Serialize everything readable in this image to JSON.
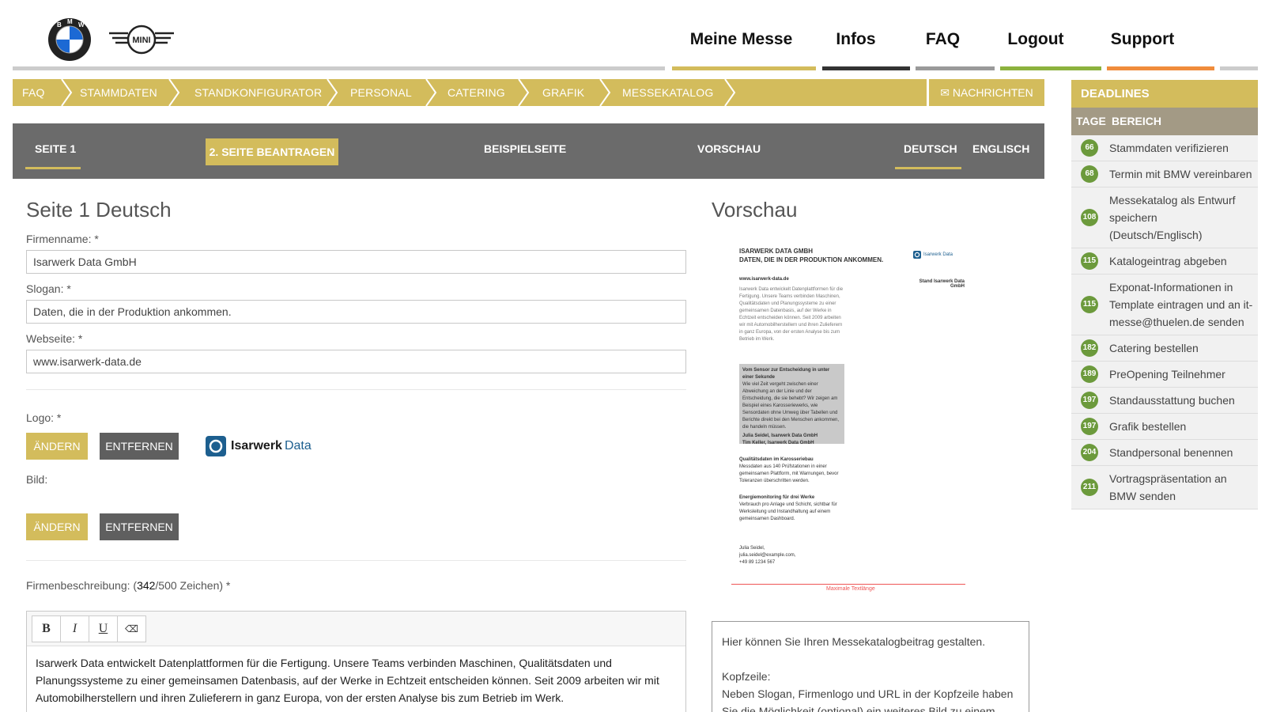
{
  "header": {
    "logos": [
      "bmw-logo",
      "mini-logo"
    ],
    "mini_logo_text": "MINI",
    "nav": [
      {
        "label": "Meine Messe",
        "color": "#d3bc5c"
      },
      {
        "label": "Infos",
        "color": "#333333"
      },
      {
        "label": "FAQ",
        "color": "#9a9a9a"
      },
      {
        "label": "Logout",
        "color": "#8cb23e"
      },
      {
        "label": "Support",
        "color": "#f08c3c"
      }
    ]
  },
  "breadcrumbs": [
    "FAQ",
    "STAMMDATEN",
    "STANDKONFIGURATOR",
    "PERSONAL",
    "CATERING",
    "GRAFIK",
    "MESSEKATALOG"
  ],
  "messages_label": "NACHRICHTEN",
  "subnav": {
    "page1": "SEITE 1",
    "apply": "2. SEITE BEANTRAGEN",
    "example": "BEISPIELSEITE",
    "preview": "VORSCHAU",
    "lang_de": "DEUTSCH",
    "lang_en": "ENGLISCH"
  },
  "form": {
    "title": "Seite 1 Deutsch",
    "company_label": "Firmenname: *",
    "company_value": "Isarwerk Data GmbH",
    "slogan_label": "Slogan: *",
    "slogan_value": "Daten, die in der Produktion ankommen.",
    "website_label": "Webseite: *",
    "website_value": "www.isarwerk-data.de",
    "logo_label": "Logo: *",
    "change_label": "ÄNDERN",
    "remove_label": "ENTFERNEN",
    "logo_brand_1": "Isarwerk",
    "logo_brand_2": "Data",
    "image_label": "Bild:",
    "desc_label_pre": "Firmenbeschreibung: (",
    "desc_count": "342",
    "desc_label_post": "/500 Zeichen) *",
    "toolbar": [
      "B",
      "I",
      "U",
      "⌫"
    ],
    "description": "Isarwerk Data entwickelt Datenplattformen für die Fertigung. Unsere Teams verbinden Maschinen, Qualitätsdaten und Planungssysteme zu einer gemeinsamen Datenbasis, auf der Werke in Echtzeit entscheiden können. Seit 2009 arbeiten wir mit Automobilherstellern und ihren Zulieferern in ganz Europa, von der ersten Analyse bis zum Betrieb im Werk."
  },
  "preview": {
    "title": "Vorschau",
    "head_1": "ISARWERK DATA GMBH",
    "head_2": "DATEN, DIE IN DER PRODUKTION ANKOMMEN.",
    "logo_text": "Isarwerk Data",
    "stand": "Stand Isarwerk Data GmbH",
    "url": "www.isarwerk-data.de",
    "body": "Isarwerk Data entwickelt Datenplattformen für die Fertigung. Unsere Teams verbinden Maschinen, Qualitätsdaten und Planungssysteme zu einer gemeinsamen Datenbasis, auf der Werke in Echtzeit entscheiden können. Seit 2009 arbeiten wir mit Automobilherstellern und ihren Zulieferern in ganz Europa, von der ersten Analyse bis zum Betrieb im Werk.",
    "box_title": "Vom Sensor zur Entscheidung in unter einer Sekunde",
    "box_body": "Wie viel Zeit vergeht zwischen einer Abweichung an der Linie und der Entscheidung, die sie behebt? Wir zeigen am Beispiel eines Karosseriewerks, wie Sensordaten ohne Umweg über Tabellen und Berichte direkt bei den Menschen ankommen, die handeln müssen.",
    "box_speakers": "Julia Seidel, Isarwerk Data GmbH\nTim Keller, Isarwerk Data GmbH",
    "item1_title": "Qualitätsdaten im Karosseriebau",
    "item1_body": "Messdaten aus 140 Prüfstationen in einer gemeinsamen Plattform, mit Warnungen, bevor Toleranzen überschritten werden.",
    "item2_title": "Energiemonitoring für drei Werke",
    "item2_body": "Verbrauch pro Anlage und Schicht, sichtbar für Werksleitung und Instandhaltung auf einem gemeinsamen Dashboard.",
    "contact": "Julia Seidel,\njulia.seidel@example.com,\n+49 89 1234 567",
    "max_label": "Maximale Textlänge",
    "info_1": "Hier können Sie Ihren Messekatalogbeitrag gestalten.",
    "info_2": "Kopfzeile:",
    "info_3": "Neben Slogan, Firmenlogo und URL in der Kopfzeile haben Sie die Möglichkeit (optional) ein weiteres Bild zu einem Ihrer"
  },
  "deadlines": {
    "title": "DEADLINES",
    "col_days": "TAGE",
    "col_area": "BEREICH",
    "badge_color": "#6c9a3c",
    "items": [
      {
        "days": "66",
        "text": "Stammdaten verifizieren"
      },
      {
        "days": "68",
        "text": "Termin mit BMW vereinbaren"
      },
      {
        "days": "108",
        "text": "Messekatalog als Entwurf speichern (Deutsch/Englisch)"
      },
      {
        "days": "115",
        "text": "Katalogeintrag abgeben"
      },
      {
        "days": "115",
        "text": "Exponat-Informationen in Template eintragen und an it-messe@thuelen.de senden"
      },
      {
        "days": "182",
        "text": "Catering bestellen"
      },
      {
        "days": "189",
        "text": "PreOpening Teilnehmer"
      },
      {
        "days": "197",
        "text": "Standausstattung buchen"
      },
      {
        "days": "197",
        "text": "Grafik bestellen"
      },
      {
        "days": "204",
        "text": "Standpersonal benennen"
      },
      {
        "days": "211",
        "text": "Vortragspräsentation an BMW senden"
      }
    ]
  }
}
